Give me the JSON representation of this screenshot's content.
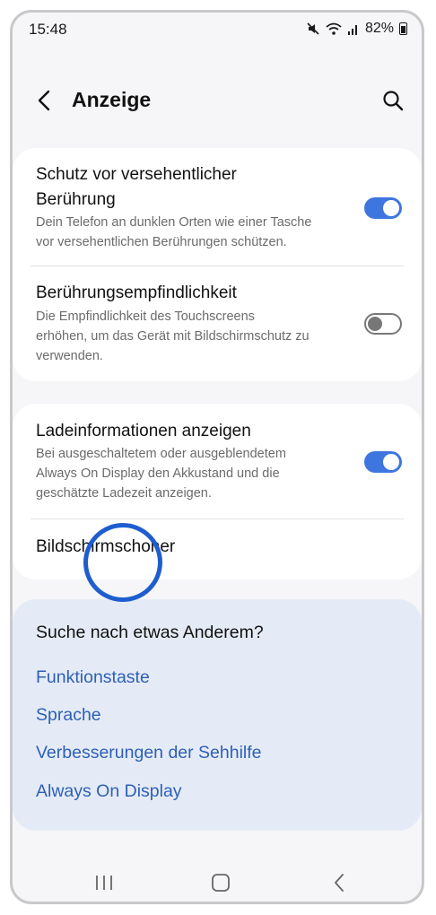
{
  "status": {
    "time": "15:48",
    "battery": "82%"
  },
  "header": {
    "title": "Anzeige"
  },
  "card1": {
    "row1": {
      "title_line1": "Schutz vor versehentlicher",
      "title_line2": "Berührung",
      "sub_line1": "Dein Telefon an dunklen Orten wie einer Tasche",
      "sub_line2": "vor versehentlichen Berührungen schützen.",
      "toggle": "on"
    },
    "row2": {
      "title": "Berührungsempfindlichkeit",
      "sub_line1": "Die Empfindlichkeit des Touchscreens",
      "sub_line2": "erhöhen, um das Gerät mit Bildschirmschutz zu",
      "sub_line3": "verwenden.",
      "toggle": "off"
    }
  },
  "card2": {
    "row1": {
      "title": "Ladeinformationen anzeigen",
      "sub_line1": "Bei ausgeschaltetem oder ausgeblendetem",
      "sub_line2": "Always On Display den Akkustand und die",
      "sub_line3": "geschätzte Ladezeit anzeigen.",
      "toggle": "on"
    },
    "row2": {
      "title": "Bildschirmschoner"
    }
  },
  "suggestions": {
    "title": "Suche nach etwas Anderem?",
    "links": [
      "Funktionstaste",
      "Sprache",
      "Verbesserungen der Sehhilfe",
      "Always On Display"
    ]
  },
  "colors": {
    "accent": "#3e76e0",
    "link": "#2d5fb8",
    "suggest_bg": "#e5ebf6"
  }
}
